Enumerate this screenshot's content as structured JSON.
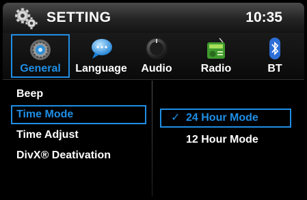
{
  "header": {
    "title": "SETTING",
    "time": "10:35",
    "icon": "gear-icon"
  },
  "tabs": [
    {
      "id": "general",
      "label": "General",
      "icon": "general-settings-icon",
      "active": true
    },
    {
      "id": "language",
      "label": "Language",
      "icon": "speech-bubble-icon",
      "active": false
    },
    {
      "id": "audio",
      "label": "Audio",
      "icon": "knob-icon",
      "active": false
    },
    {
      "id": "radio",
      "label": "Radio",
      "icon": "radio-icon",
      "active": false
    },
    {
      "id": "bt",
      "label": "BT",
      "icon": "bluetooth-icon",
      "active": false
    }
  ],
  "menu": {
    "items": [
      {
        "label": "Beep",
        "selected": false
      },
      {
        "label": "Time Mode",
        "selected": true
      },
      {
        "label": "Time Adjust",
        "selected": false
      },
      {
        "label": "DivX® Deativation",
        "selected": false
      }
    ]
  },
  "options": {
    "check_glyph": "✓",
    "items": [
      {
        "label": "24 Hour Mode",
        "selected": true
      },
      {
        "label": "12 Hour Mode",
        "selected": false
      }
    ]
  },
  "colors": {
    "accent": "#1f8ee6",
    "background": "#000000",
    "text": "#ffffff"
  }
}
